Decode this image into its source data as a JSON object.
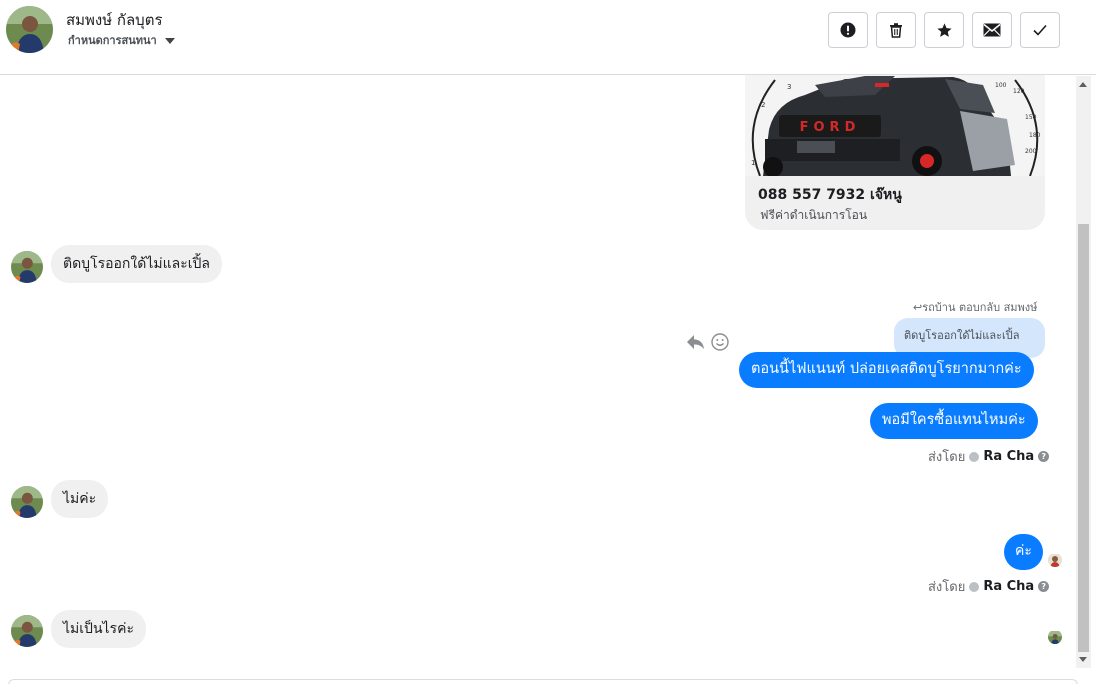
{
  "header": {
    "contact_name": "สมพงษ์ กัลบุตร",
    "assign_label": "กำหนดการสนทนา"
  },
  "toolbar": [
    {
      "name": "mark-spam-button",
      "icon": "exclamation-circle-icon"
    },
    {
      "name": "delete-button",
      "icon": "trash-icon"
    },
    {
      "name": "star-button",
      "icon": "star-icon"
    },
    {
      "name": "mark-unread-button",
      "icon": "envelope-icon"
    },
    {
      "name": "mark-done-button",
      "icon": "checkmark-icon"
    }
  ],
  "card": {
    "title": "088 557 7932 เจ๊หนู",
    "subtitle": "ฟรีค่าดำเนินการโอน",
    "grille_text": "FORD",
    "gauge_left": [
      "1",
      "2",
      "3"
    ],
    "gauge_right": [
      "100",
      "120",
      "150",
      "180",
      "200"
    ]
  },
  "messages": {
    "in1": "ติดบูโรออกใด้ไม่และเปิ้ล",
    "reply_meta": "รถบ้าน ตอบกลับ สมพงษ์",
    "quoted": "ติดบูโรออกใด้ไม่และเปิ้ล",
    "out1": "ตอนนี้ไฟแนนท์ ปล่อยเคสติดบูโรยากมากค่ะ",
    "out2": "พอมีใครซื้อแทนไหมค่ะ",
    "sent_by_label": "ส่งโดย",
    "agent_name": "Ra Cha",
    "in2": "ไม่ค่ะ",
    "out3": "ค่ะ",
    "sent_by_label_2": "ส่งโดย",
    "agent_name_2": "Ra Cha",
    "in3": "ไม่เป็นไรค่ะ"
  },
  "colors": {
    "outgoing_bubble": "#0a7cff",
    "incoming_bubble": "#f1f0f0",
    "quoted_bubble": "#d4e6fc"
  }
}
